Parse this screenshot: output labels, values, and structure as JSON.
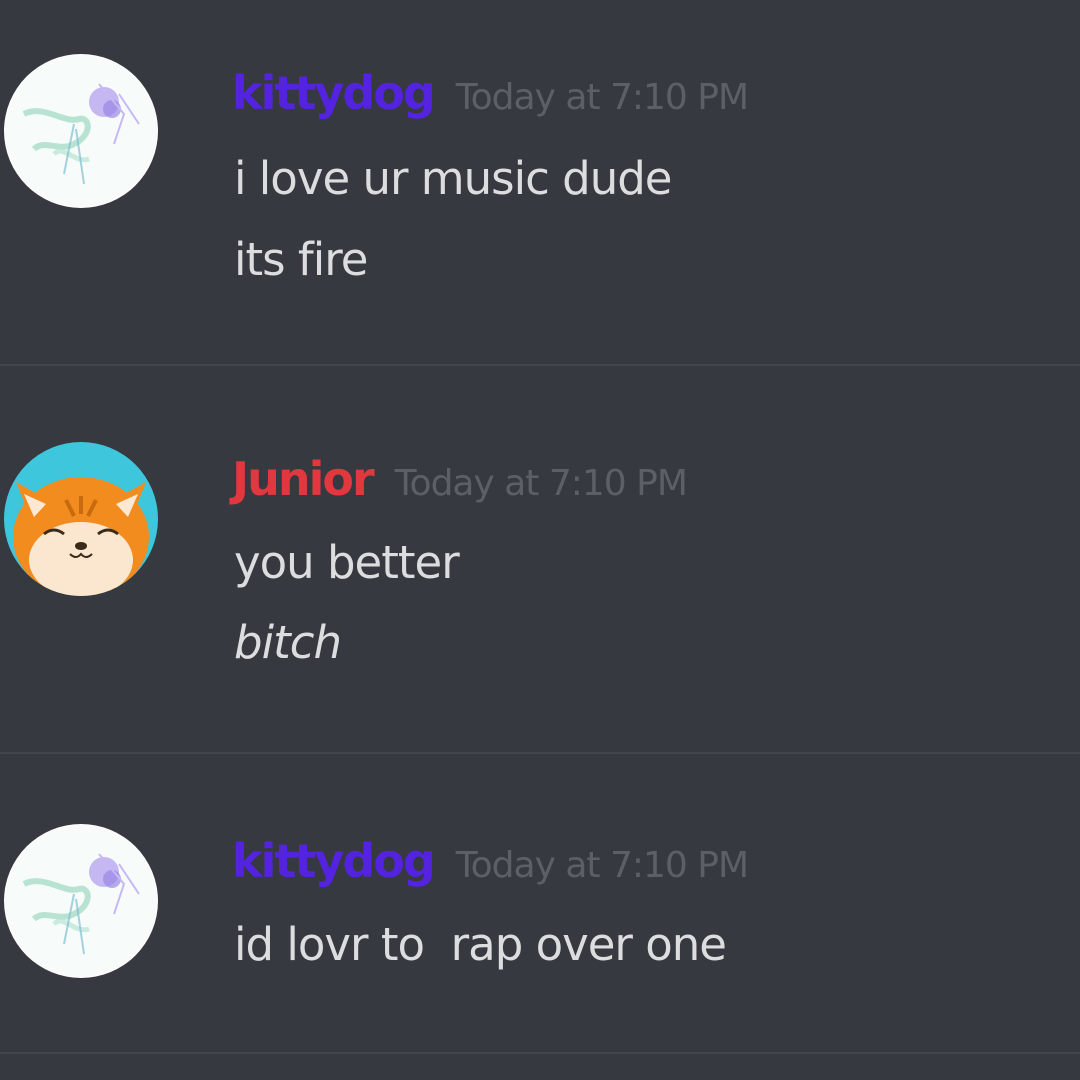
{
  "colors": {
    "background": "#36393f",
    "username_kittydog": "#5323e0",
    "username_junior": "#e0383e",
    "timestamp": "#5c5f66",
    "message_text": "#dcddde"
  },
  "messages": [
    {
      "username": "kittydog",
      "timestamp": "Today at 7:10 PM",
      "lines": [
        "i love ur music dude",
        "its fire"
      ],
      "avatar": "watercolor-flower-avatar"
    },
    {
      "username": "Junior",
      "timestamp": "Today at 7:10 PM",
      "lines": [
        "you better",
        "bitch"
      ],
      "avatar": "orange-cat-avatar"
    },
    {
      "username": "kittydog",
      "timestamp": "Today at 7:10 PM",
      "lines": [
        "id lovr to  rap over one"
      ],
      "avatar": "watercolor-flower-avatar"
    }
  ]
}
